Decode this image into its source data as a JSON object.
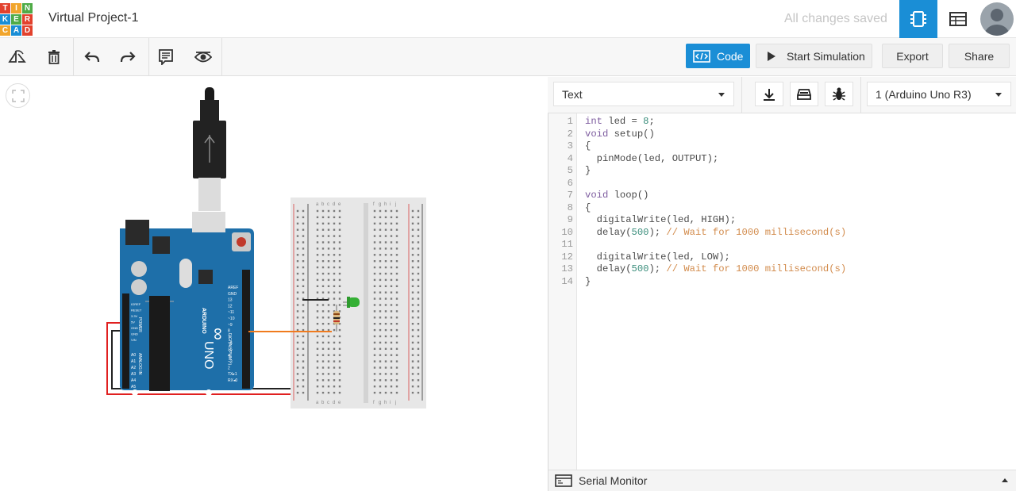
{
  "app": {
    "logo_letters": [
      "T",
      "I",
      "N",
      "K",
      "E",
      "R",
      "C",
      "A",
      "D"
    ],
    "logo_colors": [
      "#e2412d",
      "#f1a52c",
      "#4fab47",
      "#1a8ed6",
      "#4fab47",
      "#e2412d",
      "#f1a52c",
      "#1a8ed6",
      "#e2412d"
    ],
    "project_title": "Virtual Project-1",
    "save_status": "All changes saved",
    "accent_color": "#1a8ed6"
  },
  "topbar_icons": [
    "circuit-view-icon",
    "component-list-icon",
    "user-avatar"
  ],
  "toolbar": {
    "tools": [
      "rotate-icon",
      "delete-icon",
      "undo-icon",
      "redo-icon",
      "notes-icon",
      "visibility-icon"
    ],
    "code_label": "Code",
    "simulate_label": "Start Simulation",
    "export_label": "Export",
    "share_label": "Share"
  },
  "code_panel": {
    "mode_select": "Text",
    "device_select": "1 (Arduino Uno R3)",
    "icons": [
      "download-icon",
      "library-icon",
      "debugger-icon"
    ],
    "serial_monitor_label": "Serial Monitor",
    "lines": [
      {
        "n": "1",
        "parts": [
          [
            "kw",
            "int"
          ],
          [
            "p",
            " led = "
          ],
          [
            "num",
            "8"
          ],
          [
            "p",
            ";"
          ]
        ]
      },
      {
        "n": "2",
        "parts": [
          [
            "kw",
            "void"
          ],
          [
            "p",
            " setup()"
          ]
        ]
      },
      {
        "n": "3",
        "parts": [
          [
            "p",
            "{"
          ]
        ]
      },
      {
        "n": "4",
        "parts": [
          [
            "p",
            "  pinMode(led, OUTPUT);"
          ]
        ]
      },
      {
        "n": "5",
        "parts": [
          [
            "p",
            "}"
          ]
        ]
      },
      {
        "n": "6",
        "parts": [
          [
            "p",
            ""
          ]
        ]
      },
      {
        "n": "7",
        "parts": [
          [
            "kw",
            "void"
          ],
          [
            "p",
            " loop()"
          ]
        ]
      },
      {
        "n": "8",
        "parts": [
          [
            "p",
            "{"
          ]
        ]
      },
      {
        "n": "9",
        "parts": [
          [
            "p",
            "  digitalWrite(led, HIGH);"
          ]
        ]
      },
      {
        "n": "10",
        "parts": [
          [
            "p",
            "  delay("
          ],
          [
            "num",
            "500"
          ],
          [
            "p",
            "); "
          ],
          [
            "cm",
            "// Wait for 1000 millisecond(s)"
          ]
        ]
      },
      {
        "n": "11",
        "parts": [
          [
            "p",
            ""
          ]
        ]
      },
      {
        "n": "12",
        "parts": [
          [
            "p",
            "  digitalWrite(led, LOW);"
          ]
        ]
      },
      {
        "n": "13",
        "parts": [
          [
            "p",
            "  delay("
          ],
          [
            "num",
            "500"
          ],
          [
            "p",
            "); "
          ],
          [
            "cm",
            "// Wait for 1000 millisecond(s)"
          ]
        ]
      },
      {
        "n": "14",
        "parts": [
          [
            "p",
            "}"
          ]
        ]
      }
    ]
  },
  "circuit": {
    "board_brand": "ARDUINO",
    "board_model": "UNO",
    "board_logo": "∞",
    "header_labels": [
      "AREF",
      "GND",
      "13",
      "12",
      "~11",
      "~10",
      "~9",
      "8",
      "7",
      "~6",
      "~5",
      "4",
      "~3",
      "2",
      "TX▸1",
      "RX◂0"
    ],
    "power_labels": [
      "IOREF",
      "RESET",
      "3.3V",
      "5V",
      "GND",
      "GND",
      "VIN"
    ],
    "analog_labels": [
      "A0",
      "A1",
      "A2",
      "A3",
      "A4",
      "A5"
    ],
    "digital_caption": "DIGITAL (PWM ~)",
    "power_caption": "POWER",
    "analog_caption": "ANALOG IN",
    "breadboard_cols_left": [
      "a",
      "b",
      "c",
      "d",
      "e"
    ],
    "breadboard_cols_right": [
      "f",
      "g",
      "h",
      "i",
      "j"
    ],
    "wire_colors": {
      "power": "#e02020",
      "ground": "#222222",
      "signal": "#f07b1e"
    },
    "led_color": "#35b035"
  }
}
